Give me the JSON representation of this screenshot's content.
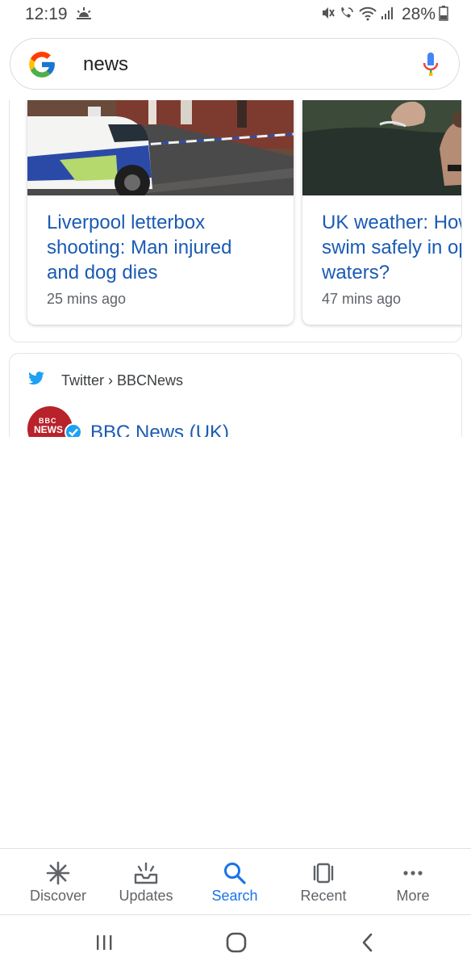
{
  "status_bar": {
    "time": "12:19",
    "battery_percent": "28%"
  },
  "search": {
    "query": "news"
  },
  "news_cards": [
    {
      "title_lines": [
        "Liverpool letterbox",
        "shooting: Man injured",
        "and dog dies"
      ],
      "time": "25 mins ago"
    },
    {
      "title_lines": [
        "UK weather: How",
        "swim safely in op",
        "waters?"
      ],
      "time": "47 mins ago"
    }
  ],
  "twitter": {
    "source": "Twitter › BBCNews",
    "avatar_line1": "BBC",
    "avatar_line2": "NEWS",
    "account_name": "BBC News (UK)"
  },
  "bottom_nav": {
    "items": [
      {
        "label": "Discover",
        "icon": "asterisk-icon"
      },
      {
        "label": "Updates",
        "icon": "inbox-icon"
      },
      {
        "label": "Search",
        "icon": "search-icon",
        "active": true
      },
      {
        "label": "Recent",
        "icon": "cards-icon"
      },
      {
        "label": "More",
        "icon": "more-dots-icon"
      }
    ]
  },
  "colors": {
    "link_blue": "#1a5bb4",
    "active_blue": "#1a73e8",
    "bbc_red": "#b8222a",
    "twitter_blue": "#1da1f2"
  }
}
